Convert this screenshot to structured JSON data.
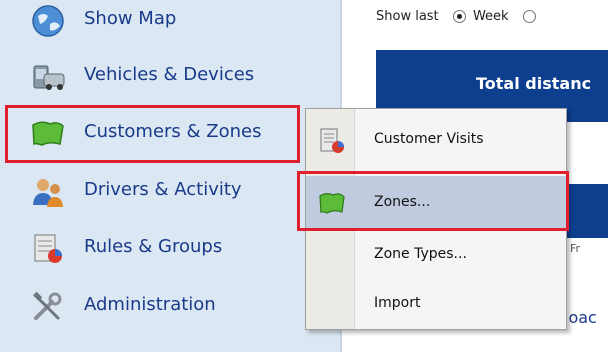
{
  "sidebar": {
    "items": [
      {
        "label": "Show Map",
        "icon": "globe-icon"
      },
      {
        "label": "Vehicles & Devices",
        "icon": "vehicle-device-icon"
      },
      {
        "label": "Customers & Zones",
        "icon": "zone-icon"
      },
      {
        "label": "Drivers & Activity",
        "icon": "drivers-icon"
      },
      {
        "label": "Rules & Groups",
        "icon": "rules-icon"
      },
      {
        "label": "Administration",
        "icon": "tools-icon"
      }
    ]
  },
  "content": {
    "show_last_label": "Show last",
    "radio_week_label": "Week",
    "total_title": "Total distanc",
    "strip_label": "Fr",
    "download_text": "loac"
  },
  "context_menu": {
    "items": [
      {
        "label": "Customer Visits",
        "icon": "customer-visits-icon"
      },
      {
        "label": "Zones...",
        "icon": "zone-icon"
      },
      {
        "label": "Zone Types..."
      },
      {
        "label": "Import"
      }
    ]
  },
  "colors": {
    "sidebar_bg": "#dbe8f3",
    "link_blue": "#1a3a8a",
    "panel_blue": "#0e3f8e",
    "highlight_red": "#e0202f",
    "menu_selected": "#c1cbe0"
  }
}
